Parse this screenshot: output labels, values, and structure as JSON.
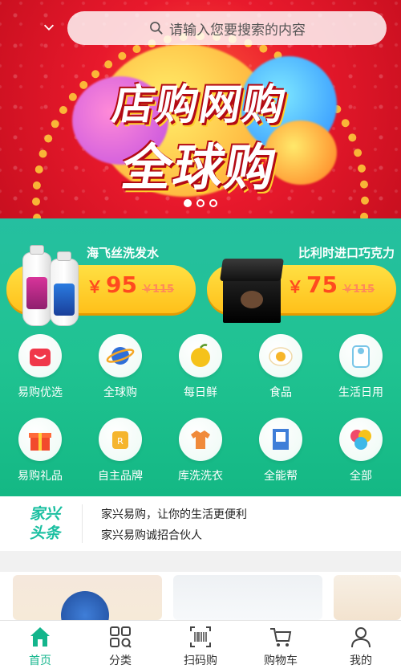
{
  "search": {
    "placeholder": "请输入您要搜索的内容"
  },
  "banner": {
    "title_line1": "店购网购",
    "title_line2": "全球购",
    "slide_count": 3,
    "active_slide": 0
  },
  "promos": [
    {
      "title": "海飞丝洗发水",
      "currency": "￥",
      "price": "95",
      "original_price": "￥115"
    },
    {
      "title": "比利时进口巧克力",
      "currency": "￥",
      "price": "75",
      "original_price": "￥115"
    }
  ],
  "categories": [
    {
      "label": "易购优选",
      "icon": "bag-icon",
      "color": "#f0384a"
    },
    {
      "label": "全球购",
      "icon": "planet-icon",
      "color": "#2f6fd8"
    },
    {
      "label": "每日鲜",
      "icon": "fruit-icon",
      "color": "#f5c21b"
    },
    {
      "label": "食品",
      "icon": "egg-icon",
      "color": "#f7b62a"
    },
    {
      "label": "生活日用",
      "icon": "tissue-roll-icon",
      "color": "#7ac6e8"
    },
    {
      "label": "易购礼品",
      "icon": "gift-icon",
      "color": "#f24a2c"
    },
    {
      "label": "自主品牌",
      "icon": "brand-icon",
      "color": "#f5b52e"
    },
    {
      "label": "库洗洗衣",
      "icon": "shirt-icon",
      "color": "#f08a3a"
    },
    {
      "label": "全能帮",
      "icon": "book-icon",
      "color": "#3f7ed8"
    },
    {
      "label": "全部",
      "icon": "all-icon",
      "color": "#f04a6a"
    }
  ],
  "news": {
    "logo_line1": "家兴",
    "logo_line2": "头条",
    "items": [
      "家兴易购，让你的生活更便利",
      "家兴易购诚招合伙人"
    ]
  },
  "tabbar": {
    "active": 0,
    "items": [
      {
        "label": "首页",
        "icon": "home-icon"
      },
      {
        "label": "分类",
        "icon": "category-icon"
      },
      {
        "label": "扫码购",
        "icon": "barcode-scan-icon"
      },
      {
        "label": "购物车",
        "icon": "cart-icon"
      },
      {
        "label": "我的",
        "icon": "user-icon"
      }
    ]
  },
  "colors": {
    "brand_green": "#13b58c",
    "banner_red": "#e8192c",
    "price_red": "#ff4a1f",
    "pill_yellow": "#ffc01a"
  }
}
